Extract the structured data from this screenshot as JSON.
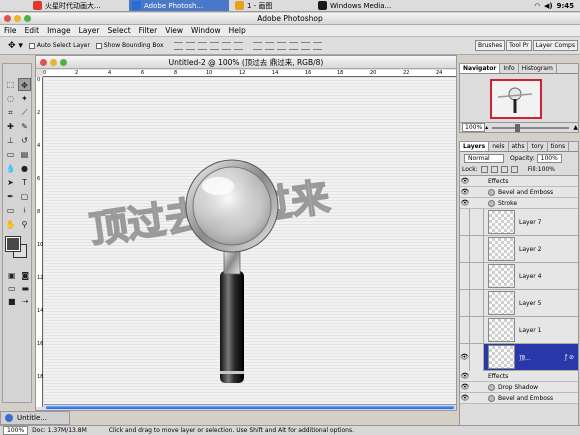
{
  "taskbar": {
    "tasks": [
      {
        "label": "火星时代动画大...",
        "icon_color": "#e2372b",
        "active": false
      },
      {
        "label": "Adobe Photosh...",
        "icon_color": "#2a6bd6",
        "active": true
      },
      {
        "label": "1 - 画图",
        "icon_color": "#e9a21a",
        "active": false
      },
      {
        "label": "Windows Media...",
        "icon_color": "#1a1a1a",
        "active": false
      }
    ],
    "clock": "9:45"
  },
  "app_title": "Adobe Photoshop",
  "menu": [
    "File",
    "Edit",
    "Image",
    "Layer",
    "Select",
    "Filter",
    "View",
    "Window",
    "Help"
  ],
  "options": {
    "auto_select_label": "Auto Select Layer",
    "bounding_box_label": "Show Bounding Box",
    "well_tabs": [
      "Brushes",
      "Tool Pr",
      "Layer Comps"
    ]
  },
  "document": {
    "title": "Untitled-2 @ 100% (顶过去 鼎过来, RGB/8)",
    "ruler_h": [
      "0",
      "2",
      "4",
      "6",
      "8",
      "10",
      "12",
      "14",
      "16",
      "18",
      "20",
      "22",
      "24"
    ],
    "ruler_v": [
      "0",
      "2",
      "4",
      "6",
      "8",
      "10",
      "12",
      "14",
      "16",
      "18"
    ],
    "artwork_text": "顶过去 鼎过来",
    "text_color": "#8c8c8c"
  },
  "navigator": {
    "tabs": [
      "Navigator",
      "Info",
      "Histogram"
    ],
    "zoom": "100%"
  },
  "layers": {
    "tabs": [
      "Layers",
      "nels",
      "aths",
      "tory",
      "tions"
    ],
    "blend_mode": "Normal",
    "opacity_label": "Opacity:",
    "opacity": "100%",
    "lock_label": "Lock:",
    "fill_label": "Fill:",
    "fill": "100%",
    "top_effects": [
      "Effects",
      "Bevel and Emboss",
      "Stroke"
    ],
    "items": [
      "Layer 7",
      "Layer 2",
      "Layer 4",
      "Layer 5",
      "Layer 1"
    ],
    "selected_layer": "顶...",
    "bottom_effects": [
      "Effects",
      "Drop Shadow",
      "Bevel and Emboss"
    ]
  },
  "status": {
    "zoom": "100%",
    "doc": "Doc: 1.37M/13.8M",
    "hint": "Click and drag to move layer or selection.  Use Shift and Alt for additional options."
  },
  "minimized_window": "Untitle..."
}
